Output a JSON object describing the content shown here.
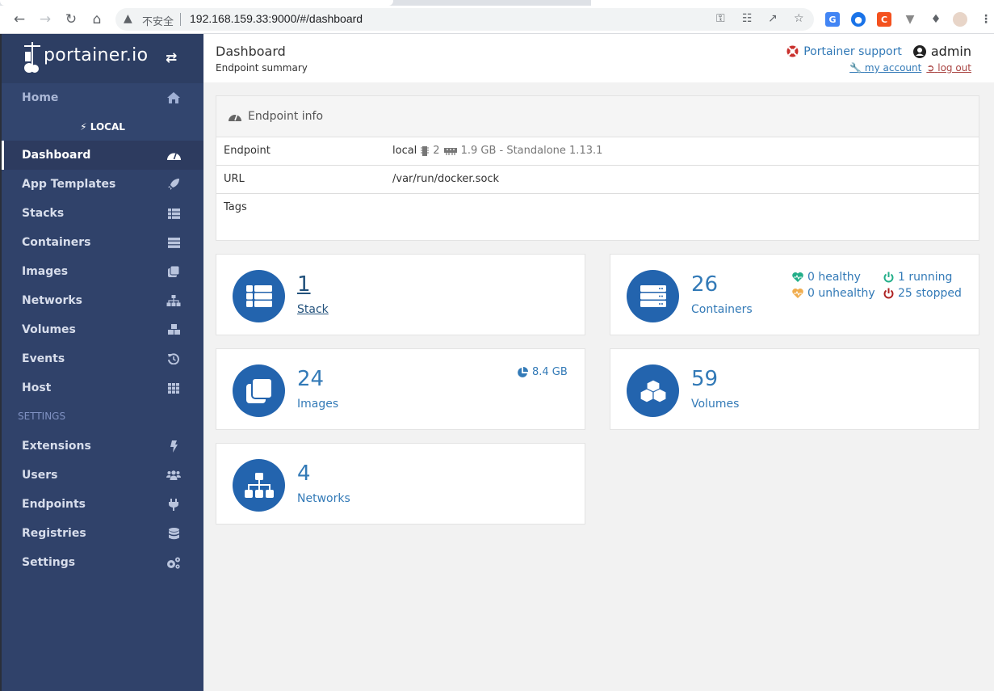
{
  "browser": {
    "insecure_label": "不安全",
    "url": "192.168.159.33:9000/#/dashboard",
    "ext_c_label": "C"
  },
  "sidebar": {
    "brand": "portainer.io",
    "endpoint_label": "LOCAL",
    "section_label": "SETTINGS",
    "items": [
      {
        "label": "Home"
      },
      {
        "label": "Dashboard"
      },
      {
        "label": "App Templates"
      },
      {
        "label": "Stacks"
      },
      {
        "label": "Containers"
      },
      {
        "label": "Images"
      },
      {
        "label": "Networks"
      },
      {
        "label": "Volumes"
      },
      {
        "label": "Events"
      },
      {
        "label": "Host"
      }
    ],
    "settings_items": [
      {
        "label": "Extensions"
      },
      {
        "label": "Users"
      },
      {
        "label": "Endpoints"
      },
      {
        "label": "Registries"
      },
      {
        "label": "Settings"
      }
    ]
  },
  "header": {
    "title": "Dashboard",
    "subtitle": "Endpoint summary",
    "support_label": "Portainer support",
    "username": "admin",
    "my_account_label": "my account",
    "log_out_label": "log out"
  },
  "endpoint_info": {
    "title": "Endpoint info",
    "rows": [
      {
        "key": "Endpoint",
        "name": "local",
        "cpu": "2",
        "memory": "1.9 GB - Standalone 1.13.1"
      },
      {
        "key": "URL",
        "value": "/var/run/docker.sock"
      },
      {
        "key": "Tags",
        "value": ""
      }
    ]
  },
  "widgets": {
    "stacks": {
      "count": "1",
      "label": "Stack"
    },
    "containers": {
      "count": "26",
      "label": "Containers",
      "healthy": "0 healthy",
      "unhealthy": "0 unhealthy",
      "running": "1 running",
      "stopped": "25 stopped"
    },
    "images": {
      "count": "24",
      "label": "Images",
      "size": "8.4 GB"
    },
    "volumes": {
      "count": "59",
      "label": "Volumes"
    },
    "networks": {
      "count": "4",
      "label": "Networks"
    }
  },
  "colors": {
    "sidebar_bg": "#30426a",
    "accent_blue": "#2364ae",
    "link_blue": "#337ab7",
    "healthy_green": "#23ae89",
    "unhealthy_orange": "#f0ad4e",
    "stopped_red": "#ae2323"
  }
}
